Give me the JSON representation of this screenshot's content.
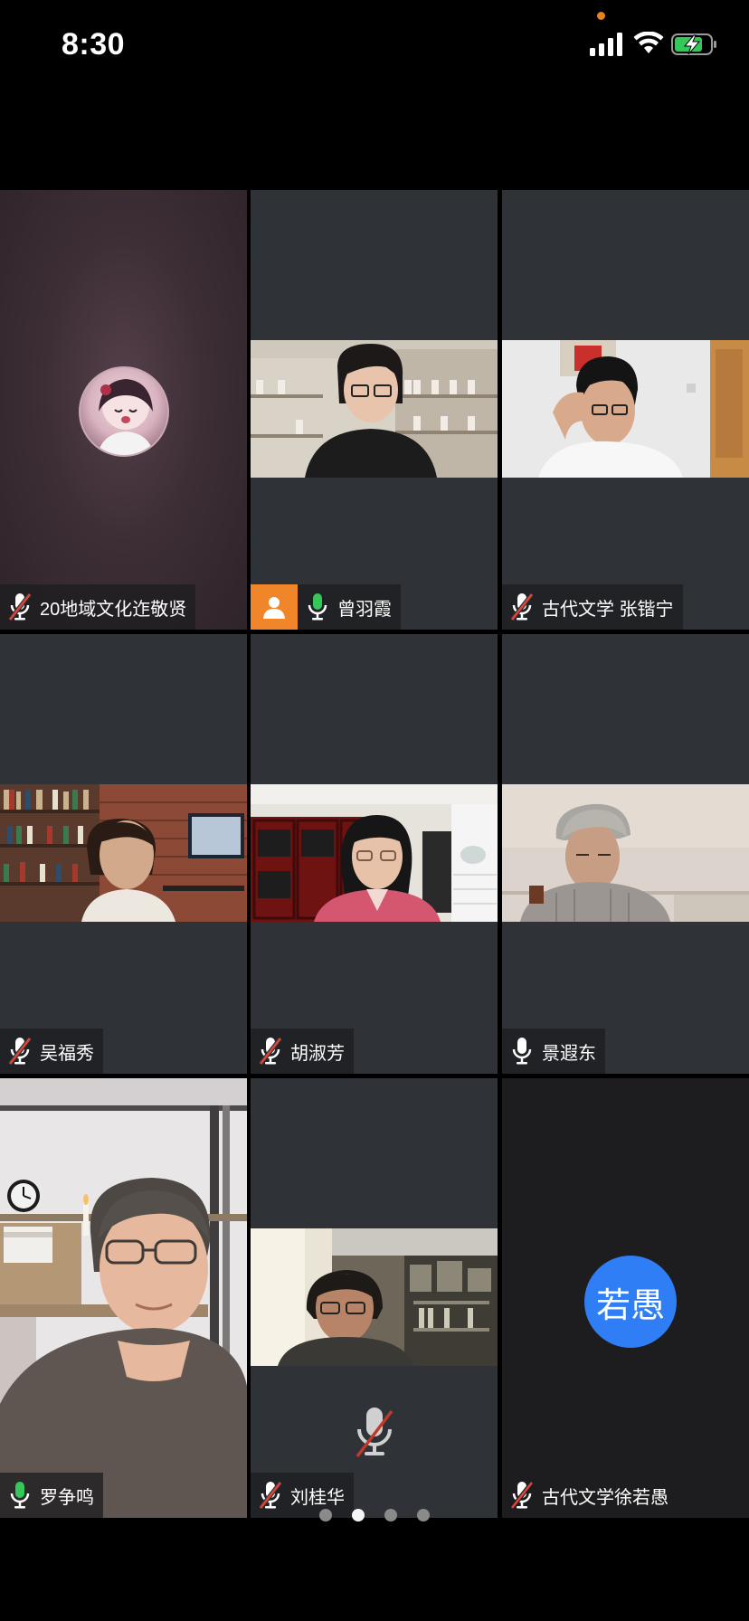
{
  "status_bar": {
    "time": "8:30"
  },
  "participants": [
    {
      "name": "20地域文化迮敬贤",
      "muted": true
    },
    {
      "name": "曾羽霞",
      "muted": false,
      "mic_color": "#35c759"
    },
    {
      "name": "古代文学 张锴宁",
      "muted": true
    },
    {
      "name": "吴福秀",
      "muted": true
    },
    {
      "name": "胡淑芳",
      "muted": true
    },
    {
      "name": "景遐东",
      "muted": false,
      "mic_color": "#ffffff"
    },
    {
      "name": "罗争鸣",
      "muted": false,
      "mic_color": "#35c759",
      "speaking": true
    },
    {
      "name": "刘桂华",
      "muted": true
    },
    {
      "name": "古代文学徐若愚",
      "muted": true,
      "initials": "若愚"
    }
  ],
  "pager": {
    "pages": 4,
    "current": 2
  },
  "colors": {
    "accent_blue": "#2f7ef5",
    "speaking_border": "#3ec26a",
    "profile_badge": "#f0852a"
  }
}
